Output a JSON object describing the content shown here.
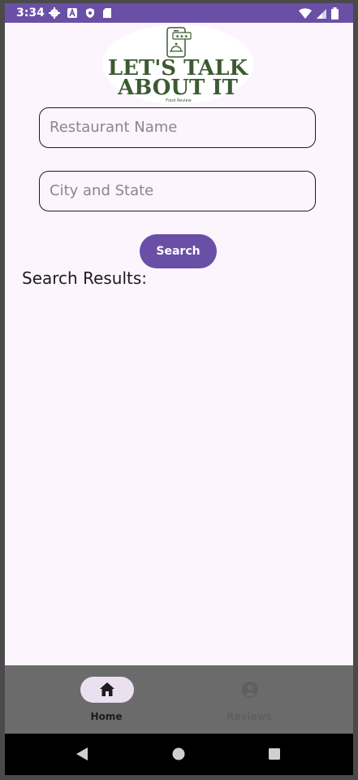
{
  "status_bar": {
    "time": "3:34",
    "left_icons": [
      "gear-icon",
      "a-icon",
      "shield-icon",
      "sd-card-icon"
    ],
    "right_icons": [
      "wifi-icon",
      "signal-icon",
      "battery-icon"
    ]
  },
  "colors": {
    "primary": "#6a4fa6",
    "background": "#fdf5fd",
    "logo_green": "#3d5a33",
    "nav_background": "#6b6b6b"
  },
  "logo": {
    "line1": "LET'S TALK",
    "line2": "ABOUT IT",
    "tagline": "Food Review"
  },
  "form": {
    "restaurant_placeholder": "Restaurant Name",
    "city_placeholder": "City and State",
    "search_label": "Search"
  },
  "results": {
    "label": "Search Results:"
  },
  "bottom_nav": {
    "items": [
      {
        "label": "Home",
        "icon": "home-icon",
        "active": true
      },
      {
        "label": "Reviews",
        "icon": "account-circle-icon",
        "active": false
      }
    ]
  },
  "system_nav": [
    "back-icon",
    "home-circle-icon",
    "recents-icon"
  ]
}
